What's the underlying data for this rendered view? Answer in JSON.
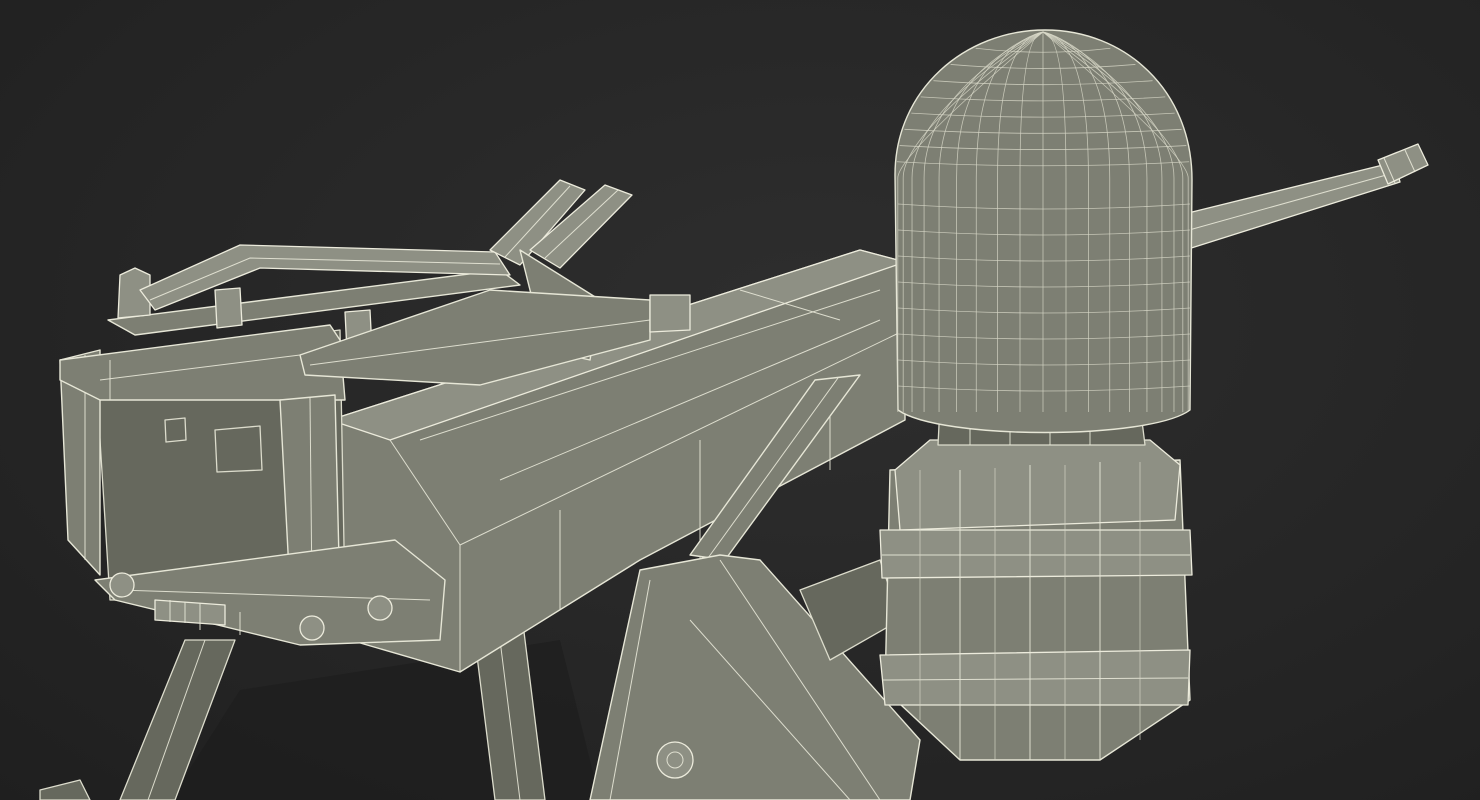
{
  "scene": {
    "background_color": "#262626",
    "model_fill_color": "#7d7f73",
    "wire_color": "#e8e8d8"
  }
}
